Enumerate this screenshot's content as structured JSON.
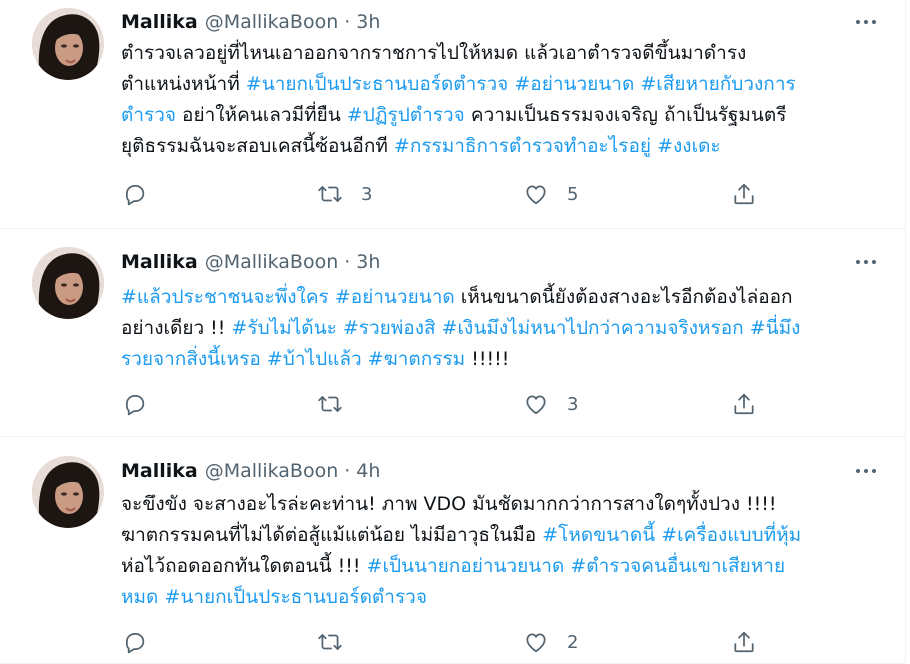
{
  "tweets": [
    {
      "name": "Mallika",
      "handle": "@MallikaBoon",
      "separator": "·",
      "time": "3h",
      "lines": [
        [
          {
            "t": "ตำรวจเลวอยู่ที่ไหนเอาออกจากราชการไปให้หมด แล้วเอาตำรวจดีขึ้นมาดำรง",
            "h": false
          }
        ],
        [
          {
            "t": "ตำแหน่งหน้าที่ ",
            "h": false
          },
          {
            "t": "#นายกเป็นประธานบอร์ดตำรวจ",
            "h": true
          },
          {
            "t": " ",
            "h": false
          },
          {
            "t": "#อย่านวยนาด",
            "h": true
          },
          {
            "t": " ",
            "h": false
          },
          {
            "t": "#เสียหายกับวงการ",
            "h": true
          }
        ],
        [
          {
            "t": "ตำรวจ",
            "h": true
          },
          {
            "t": " อย่าให้คนเลวมีที่ยืน ",
            "h": false
          },
          {
            "t": "#ปฏิรูปตำรวจ",
            "h": true
          },
          {
            "t": " ความเป็นธรรมจงเจริญ ถ้าเป็นรัฐมนตรี",
            "h": false
          }
        ],
        [
          {
            "t": "ยุติธรรมฉันจะสอบเคสนี้ซ้อนอีกที ",
            "h": false
          },
          {
            "t": "#กรรมาธิการตำรวจทำอะไรอยู่",
            "h": true
          },
          {
            "t": " ",
            "h": false
          },
          {
            "t": "#งงเดะ",
            "h": true
          }
        ]
      ],
      "retweets": "3",
      "likes": "5"
    },
    {
      "name": "Mallika",
      "handle": "@MallikaBoon",
      "separator": "·",
      "time": "3h",
      "lines": [
        [
          {
            "t": "#แล้วประชาชนจะพึ่งใคร",
            "h": true
          },
          {
            "t": " ",
            "h": false
          },
          {
            "t": "#อย่านวยนาด",
            "h": true
          },
          {
            "t": " เห็นขนาดนี้ยังต้องสางอะไรอีกต้องไล่ออก",
            "h": false
          }
        ],
        [
          {
            "t": "อย่างเดียว !! ",
            "h": false
          },
          {
            "t": "#รับไม่ได้นะ",
            "h": true
          },
          {
            "t": " ",
            "h": false
          },
          {
            "t": "#รวยพ่องสิ",
            "h": true
          },
          {
            "t": " ",
            "h": false
          },
          {
            "t": "#เงินมึงไม่หนาไปกว่าความจริงหรอก",
            "h": true
          },
          {
            "t": " ",
            "h": false
          },
          {
            "t": "#นี่มึง",
            "h": true
          }
        ],
        [
          {
            "t": "รวยจากสิ่งนี้เหรอ",
            "h": true
          },
          {
            "t": " ",
            "h": false
          },
          {
            "t": "#บ้าไปแล้ว",
            "h": true
          },
          {
            "t": " ",
            "h": false
          },
          {
            "t": "#ฆาตกรรม",
            "h": true
          },
          {
            "t": "  !!!!!",
            "h": false
          }
        ]
      ],
      "retweets": "",
      "likes": "3"
    },
    {
      "name": "Mallika",
      "handle": "@MallikaBoon",
      "separator": "·",
      "time": "4h",
      "lines": [
        [
          {
            "t": "จะขึงขัง จะสางอะไรล่ะคะท่าน! ภาพ VDO มันชัดมากกว่าการสางใดๆทั้งปวง !!!!",
            "h": false
          }
        ],
        [
          {
            "t": "ฆาตกรรมคนที่ไม่ได้ต่อสู้แม้แต่น้อย ไม่มีอาวุธในมือ ",
            "h": false
          },
          {
            "t": "#โหดขนาดนี้",
            "h": true
          },
          {
            "t": " ",
            "h": false
          },
          {
            "t": "#เครื่องแบบที่หุ้ม",
            "h": true
          }
        ],
        [
          {
            "t": "ห่อไว้ถอดออกทันใดตอนนี้ !!! ",
            "h": false
          },
          {
            "t": "#เป็นนายกอย่านวยนาด",
            "h": true
          },
          {
            "t": " ",
            "h": false
          },
          {
            "t": "#ตำรวจคนอื่นเขาเสียหาย",
            "h": true
          }
        ],
        [
          {
            "t": "หมด",
            "h": true
          },
          {
            "t": " ",
            "h": false
          },
          {
            "t": "#นายกเป็นประธานบอร์ดตำรวจ",
            "h": true
          }
        ]
      ],
      "retweets": "",
      "likes": "2"
    }
  ],
  "icons": {
    "avatar": "profile-photo",
    "more": "more-horizontal-icon",
    "reply": "reply-icon",
    "retweet": "retweet-icon",
    "like": "heart-icon",
    "share": "share-icon"
  },
  "colors": {
    "hashtag": "#1d9bf0",
    "secondary_text": "#536471",
    "primary_text": "#0f1419",
    "divider": "#eff3f4"
  }
}
